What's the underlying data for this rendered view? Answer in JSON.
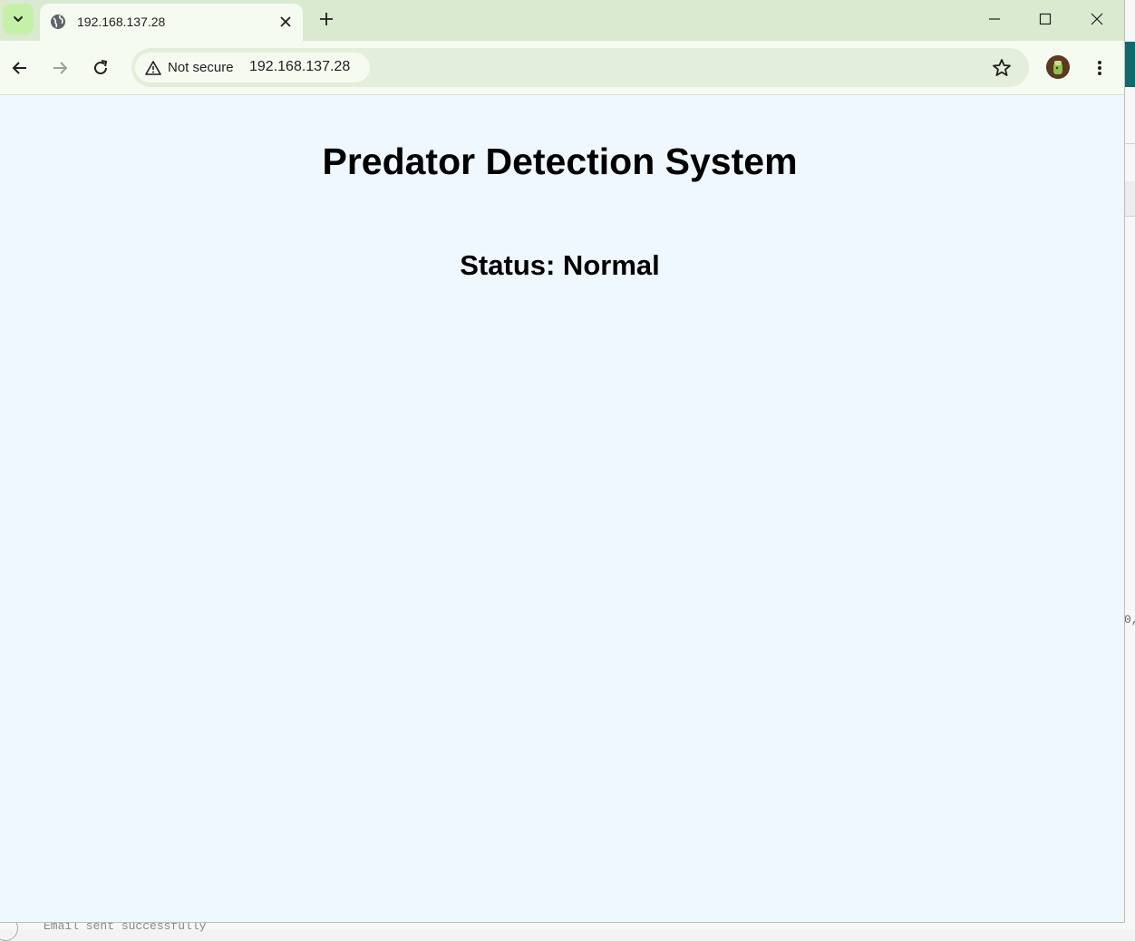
{
  "browser": {
    "tab": {
      "title": "192.168.137.28"
    },
    "address_bar": {
      "security_label": "Not secure",
      "url": "192.168.137.28"
    }
  },
  "page": {
    "heading": "Predator Detection System",
    "status": "Status: Normal"
  },
  "background_window": {
    "bottom_text": "Email sent successfully",
    "side_fragment": "0,"
  },
  "colors": {
    "tabstrip": "#d9ead0",
    "toolbar": "#f6fbf2",
    "omnibox": "#e3efda",
    "page_background": "#f0f8ff",
    "accent": "#c4f0a8"
  }
}
